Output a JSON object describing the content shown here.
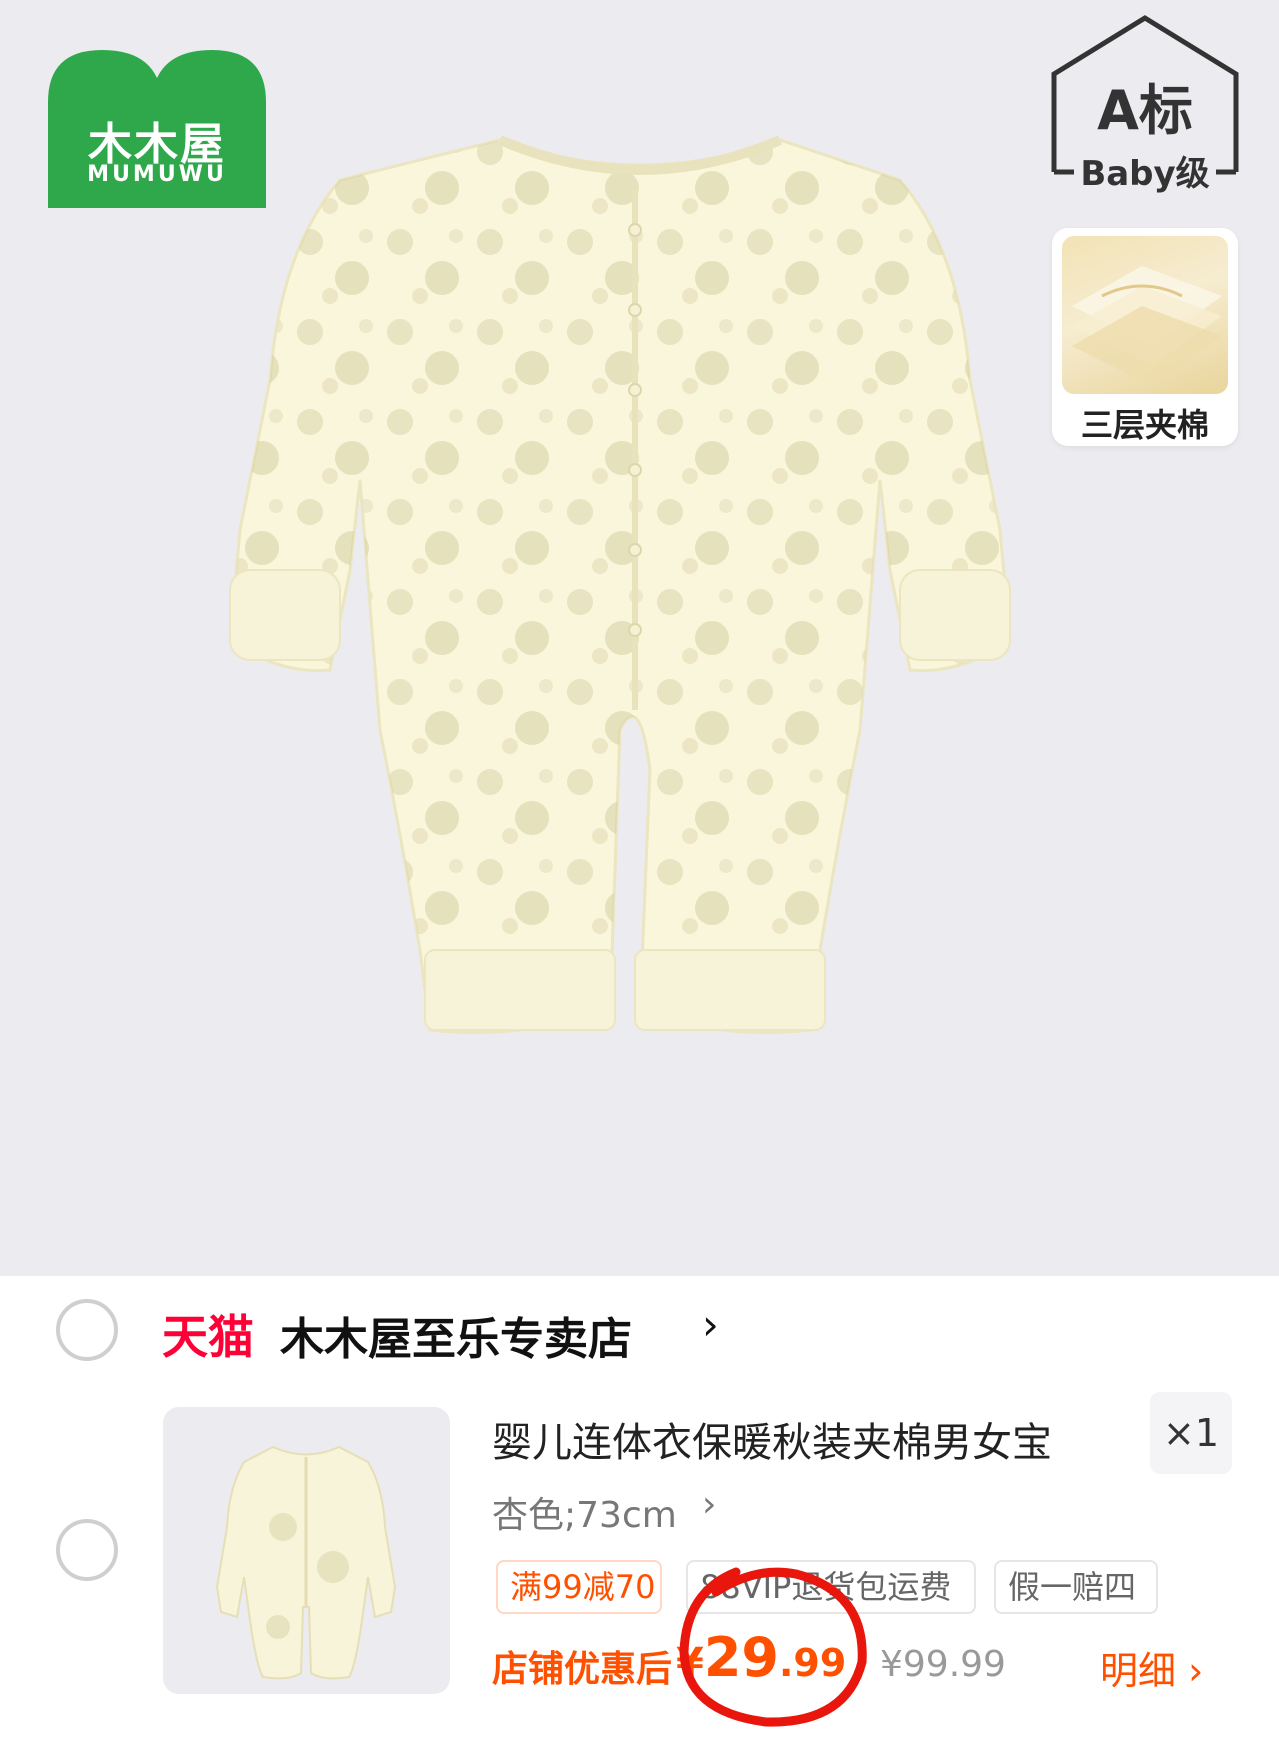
{
  "brand": {
    "name_cn": "木木屋",
    "name_en": "MUMUWU",
    "color": "#2ea84b"
  },
  "badge": {
    "line1": "A标",
    "line2": "Baby级"
  },
  "feature": {
    "label": "三层夹棉"
  },
  "store": {
    "platform": "天猫",
    "name": "木木屋至乐专卖店",
    "chevron": "›",
    "platform_color": "#ff0036"
  },
  "item": {
    "title": "婴儿连体衣保暖秋装夹棉男女宝",
    "quantity": "×1",
    "sku": "杏色;73cm",
    "sku_chevron": "›",
    "tags": [
      "满99减70",
      "88VIP退货包运费",
      "假一赔四"
    ],
    "coupon_label": "店铺优惠后",
    "price_symbol": "¥",
    "price_integer": "29",
    "price_decimal": ".99",
    "original_price": "¥99.99",
    "detail_link": "明细 ›",
    "accent_color": "#ff5000"
  },
  "icons": [
    "radio-circle-icon",
    "chevron-right-icon",
    "red-circle-annotation"
  ]
}
